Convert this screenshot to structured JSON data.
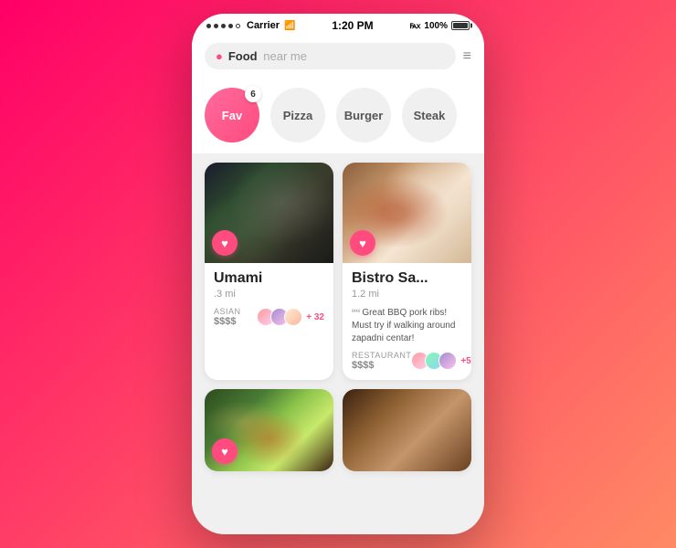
{
  "status_bar": {
    "dots": [
      "filled",
      "filled",
      "filled",
      "filled",
      "empty"
    ],
    "carrier": "Carrier",
    "wifi": "wifi",
    "time": "1:20 PM",
    "bluetooth": "bluetooth",
    "battery_pct": "100%"
  },
  "search": {
    "placeholder_bold": "Food",
    "placeholder_light": "near me",
    "location_icon": "📍",
    "filter_icon": "⚙"
  },
  "categories": [
    {
      "label": "Fav",
      "active": true,
      "badge": "6"
    },
    {
      "label": "Pizza",
      "active": false,
      "badge": ""
    },
    {
      "label": "Burger",
      "active": false,
      "badge": ""
    },
    {
      "label": "Steak",
      "active": false,
      "badge": ""
    }
  ],
  "cards": [
    {
      "id": "umami",
      "name": "Umami",
      "distance": ".3 mi",
      "tag": "ASIAN",
      "price": "$$$$",
      "likes_count": "+ 32",
      "image_class": "food-umami",
      "has_quote": false
    },
    {
      "id": "bistro",
      "name": "Bistro Sa...",
      "distance": "1.2 mi",
      "tag": "RESTAURANT",
      "price": "$$$$ ",
      "likes_count": "+5",
      "quote": "Great BBQ pork ribs! Must try if walking around zapadni centar!",
      "image_class": "food-bistro",
      "has_quote": true
    },
    {
      "id": "salad",
      "name": "",
      "distance": "",
      "tag": "",
      "price": "",
      "likes_count": "",
      "image_class": "food-salad",
      "has_quote": false,
      "partial": true
    },
    {
      "id": "fourth",
      "name": "",
      "distance": "",
      "tag": "",
      "price": "",
      "likes_count": "",
      "image_class": "food-fourth",
      "has_quote": false,
      "partial": true
    }
  ],
  "colors": {
    "pink": "#ff4b7e",
    "light_pink": "#ff6b9d",
    "gray_bg": "#f0f0f0"
  }
}
